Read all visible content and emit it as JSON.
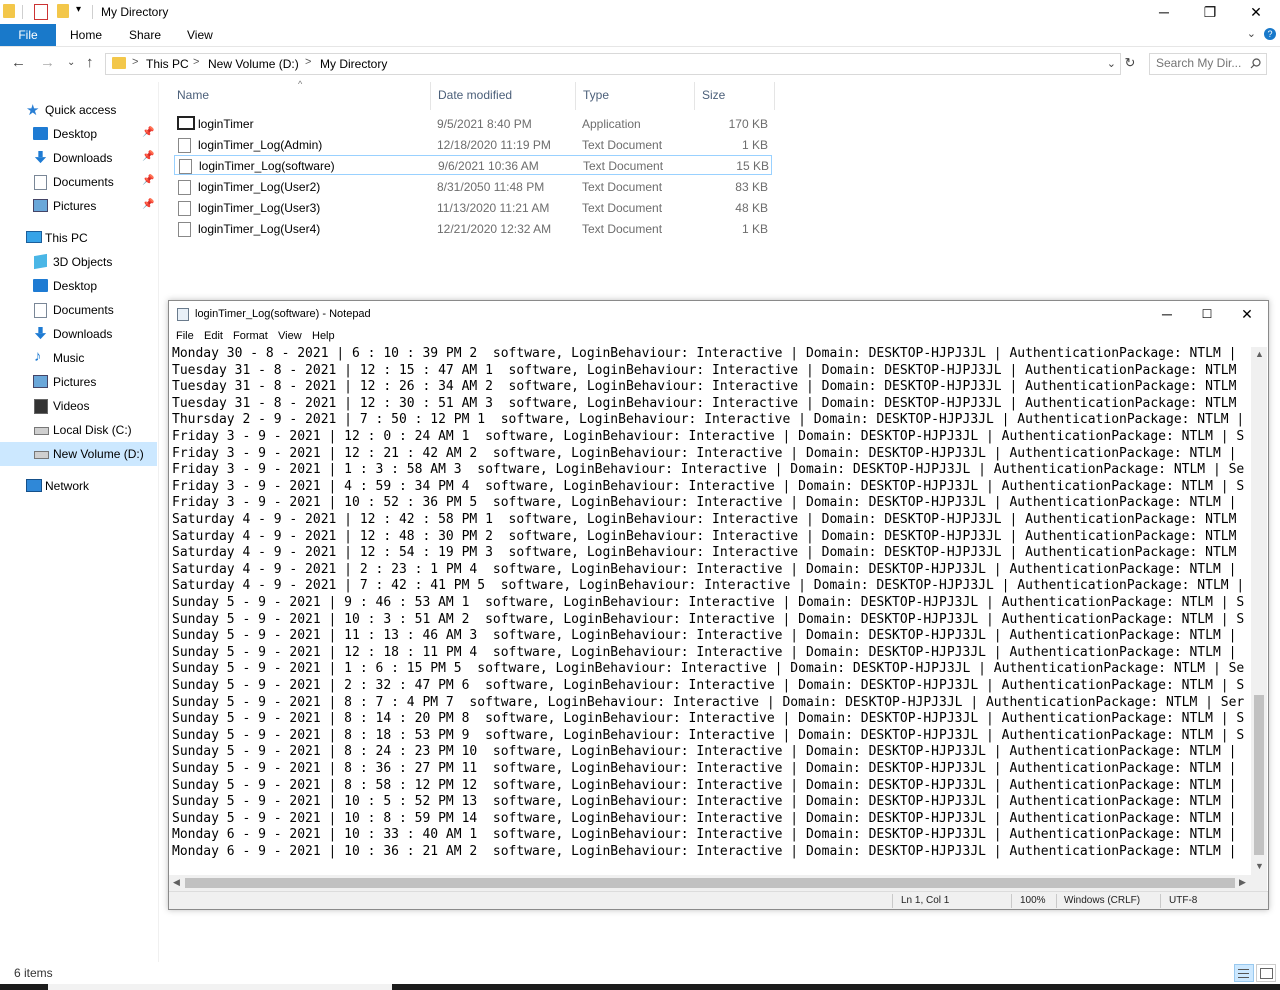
{
  "window": {
    "title": "My Directory",
    "minimize": "─",
    "restore": "❐",
    "close": "✕"
  },
  "ribbon": {
    "file": "File",
    "home": "Home",
    "share": "Share",
    "view": "View"
  },
  "address": {
    "segments": [
      "This PC",
      "New Volume (D:)",
      "My Directory"
    ],
    "separator": ">",
    "search_placeholder": "Search My Dir..."
  },
  "nav": {
    "quick_access": "Quick access",
    "quick_items": [
      "Desktop",
      "Downloads",
      "Documents",
      "Pictures"
    ],
    "this_pc": "This PC",
    "pc_items": [
      "3D Objects",
      "Desktop",
      "Documents",
      "Downloads",
      "Music",
      "Pictures",
      "Videos",
      "Local Disk (C:)",
      "New Volume (D:)"
    ],
    "network": "Network"
  },
  "columns": {
    "name": "Name",
    "date": "Date modified",
    "type": "Type",
    "size": "Size"
  },
  "files": [
    {
      "name": "loginTimer",
      "date": "9/5/2021 8:40 PM",
      "type": "Application",
      "size": "170 KB"
    },
    {
      "name": "loginTimer_Log(Admin)",
      "date": "12/18/2020 11:19 PM",
      "type": "Text Document",
      "size": "1 KB"
    },
    {
      "name": "loginTimer_Log(software)",
      "date": "9/6/2021 10:36 AM",
      "type": "Text Document",
      "size": "15 KB"
    },
    {
      "name": "loginTimer_Log(User2)",
      "date": "8/31/2050 11:48 PM",
      "type": "Text Document",
      "size": "83 KB"
    },
    {
      "name": "loginTimer_Log(User3)",
      "date": "11/13/2020 11:21 AM",
      "type": "Text Document",
      "size": "48 KB"
    },
    {
      "name": "loginTimer_Log(User4)",
      "date": "12/21/2020 12:32 AM",
      "type": "Text Document",
      "size": "1 KB"
    }
  ],
  "status": {
    "item_count": "6 items"
  },
  "notepad": {
    "title": "loginTimer_Log(software) - Notepad",
    "menu": [
      "File",
      "Edit",
      "Format",
      "View",
      "Help"
    ],
    "lines": [
      "Monday 30 - 8 - 2021 | 6 : 10 : 39 PM 2  software, LoginBehaviour: Interactive | Domain: DESKTOP-HJPJ3JL | AuthenticationPackage: NTLM |",
      "Tuesday 31 - 8 - 2021 | 12 : 15 : 47 AM 1  software, LoginBehaviour: Interactive | Domain: DESKTOP-HJPJ3JL | AuthenticationPackage: NTLM",
      "Tuesday 31 - 8 - 2021 | 12 : 26 : 34 AM 2  software, LoginBehaviour: Interactive | Domain: DESKTOP-HJPJ3JL | AuthenticationPackage: NTLM",
      "Tuesday 31 - 8 - 2021 | 12 : 30 : 51 AM 3  software, LoginBehaviour: Interactive | Domain: DESKTOP-HJPJ3JL | AuthenticationPackage: NTLM",
      "Thursday 2 - 9 - 2021 | 7 : 50 : 12 PM 1  software, LoginBehaviour: Interactive | Domain: DESKTOP-HJPJ3JL | AuthenticationPackage: NTLM |",
      "Friday 3 - 9 - 2021 | 12 : 0 : 24 AM 1  software, LoginBehaviour: Interactive | Domain: DESKTOP-HJPJ3JL | AuthenticationPackage: NTLM | S",
      "Friday 3 - 9 - 2021 | 12 : 21 : 42 AM 2  software, LoginBehaviour: Interactive | Domain: DESKTOP-HJPJ3JL | AuthenticationPackage: NTLM |",
      "Friday 3 - 9 - 2021 | 1 : 3 : 58 AM 3  software, LoginBehaviour: Interactive | Domain: DESKTOP-HJPJ3JL | AuthenticationPackage: NTLM | Se",
      "Friday 3 - 9 - 2021 | 4 : 59 : 34 PM 4  software, LoginBehaviour: Interactive | Domain: DESKTOP-HJPJ3JL | AuthenticationPackage: NTLM | S",
      "Friday 3 - 9 - 2021 | 10 : 52 : 36 PM 5  software, LoginBehaviour: Interactive | Domain: DESKTOP-HJPJ3JL | AuthenticationPackage: NTLM |",
      "Saturday 4 - 9 - 2021 | 12 : 42 : 58 PM 1  software, LoginBehaviour: Interactive | Domain: DESKTOP-HJPJ3JL | AuthenticationPackage: NTLM",
      "Saturday 4 - 9 - 2021 | 12 : 48 : 30 PM 2  software, LoginBehaviour: Interactive | Domain: DESKTOP-HJPJ3JL | AuthenticationPackage: NTLM",
      "Saturday 4 - 9 - 2021 | 12 : 54 : 19 PM 3  software, LoginBehaviour: Interactive | Domain: DESKTOP-HJPJ3JL | AuthenticationPackage: NTLM",
      "Saturday 4 - 9 - 2021 | 2 : 23 : 1 PM 4  software, LoginBehaviour: Interactive | Domain: DESKTOP-HJPJ3JL | AuthenticationPackage: NTLM |",
      "Saturday 4 - 9 - 2021 | 7 : 42 : 41 PM 5  software, LoginBehaviour: Interactive | Domain: DESKTOP-HJPJ3JL | AuthenticationPackage: NTLM |",
      "Sunday 5 - 9 - 2021 | 9 : 46 : 53 AM 1  software, LoginBehaviour: Interactive | Domain: DESKTOP-HJPJ3JL | AuthenticationPackage: NTLM | S",
      "Sunday 5 - 9 - 2021 | 10 : 3 : 51 AM 2  software, LoginBehaviour: Interactive | Domain: DESKTOP-HJPJ3JL | AuthenticationPackage: NTLM | S",
      "Sunday 5 - 9 - 2021 | 11 : 13 : 46 AM 3  software, LoginBehaviour: Interactive | Domain: DESKTOP-HJPJ3JL | AuthenticationPackage: NTLM |",
      "Sunday 5 - 9 - 2021 | 12 : 18 : 11 PM 4  software, LoginBehaviour: Interactive | Domain: DESKTOP-HJPJ3JL | AuthenticationPackage: NTLM |",
      "Sunday 5 - 9 - 2021 | 1 : 6 : 15 PM 5  software, LoginBehaviour: Interactive | Domain: DESKTOP-HJPJ3JL | AuthenticationPackage: NTLM | Se",
      "Sunday 5 - 9 - 2021 | 2 : 32 : 47 PM 6  software, LoginBehaviour: Interactive | Domain: DESKTOP-HJPJ3JL | AuthenticationPackage: NTLM | S",
      "Sunday 5 - 9 - 2021 | 8 : 7 : 4 PM 7  software, LoginBehaviour: Interactive | Domain: DESKTOP-HJPJ3JL | AuthenticationPackage: NTLM | Ser",
      "Sunday 5 - 9 - 2021 | 8 : 14 : 20 PM 8  software, LoginBehaviour: Interactive | Domain: DESKTOP-HJPJ3JL | AuthenticationPackage: NTLM | S",
      "Sunday 5 - 9 - 2021 | 8 : 18 : 53 PM 9  software, LoginBehaviour: Interactive | Domain: DESKTOP-HJPJ3JL | AuthenticationPackage: NTLM | S",
      "Sunday 5 - 9 - 2021 | 8 : 24 : 23 PM 10  software, LoginBehaviour: Interactive | Domain: DESKTOP-HJPJ3JL | AuthenticationPackage: NTLM |",
      "Sunday 5 - 9 - 2021 | 8 : 36 : 27 PM 11  software, LoginBehaviour: Interactive | Domain: DESKTOP-HJPJ3JL | AuthenticationPackage: NTLM |",
      "Sunday 5 - 9 - 2021 | 8 : 58 : 12 PM 12  software, LoginBehaviour: Interactive | Domain: DESKTOP-HJPJ3JL | AuthenticationPackage: NTLM |",
      "Sunday 5 - 9 - 2021 | 10 : 5 : 52 PM 13  software, LoginBehaviour: Interactive | Domain: DESKTOP-HJPJ3JL | AuthenticationPackage: NTLM |",
      "Sunday 5 - 9 - 2021 | 10 : 8 : 59 PM 14  software, LoginBehaviour: Interactive | Domain: DESKTOP-HJPJ3JL | AuthenticationPackage: NTLM |",
      "Monday 6 - 9 - 2021 | 10 : 33 : 40 AM 1  software, LoginBehaviour: Interactive | Domain: DESKTOP-HJPJ3JL | AuthenticationPackage: NTLM |",
      "Monday 6 - 9 - 2021 | 10 : 36 : 21 AM 2  software, LoginBehaviour: Interactive | Domain: DESKTOP-HJPJ3JL | AuthenticationPackage: NTLM |"
    ],
    "status": {
      "position": "Ln 1, Col 1",
      "zoom": "100%",
      "line_ending": "Windows (CRLF)",
      "encoding": "UTF-8"
    }
  }
}
